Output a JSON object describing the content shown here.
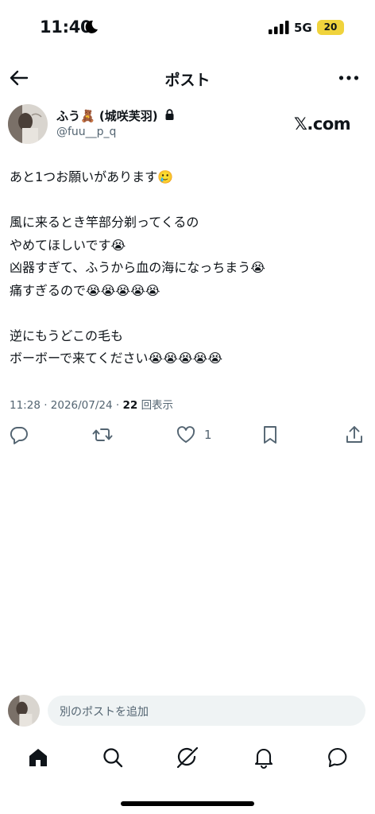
{
  "status_bar": {
    "time": "11:40",
    "network": "5G",
    "battery": "20"
  },
  "header": {
    "title": "ポスト"
  },
  "author": {
    "display_name": "ふう🧸 (城咲芙羽)",
    "handle": "@fuu__p_q",
    "site_badge": "𝕏.com"
  },
  "tweet": {
    "lines": [
      "あと1つお願いがあります🥲",
      "",
      "風に来るとき竿部分剃ってくるの",
      "やめてほしいです😭",
      "凶器すぎて、ふうから血の海になっちまう😭",
      "痛すぎるので😭😭😭😭😭",
      "",
      "逆にもうどこの毛も",
      "ボーボーで来てください😭😭😭😭😭"
    ],
    "time": "11:28",
    "date": "2026/07/24",
    "views": "22",
    "views_label": "回表示",
    "like_count": "1"
  },
  "reply": {
    "placeholder": "別のポストを追加"
  },
  "nav": [
    "home-icon",
    "search-icon",
    "grok-icon",
    "notifications-icon",
    "messages-icon"
  ]
}
